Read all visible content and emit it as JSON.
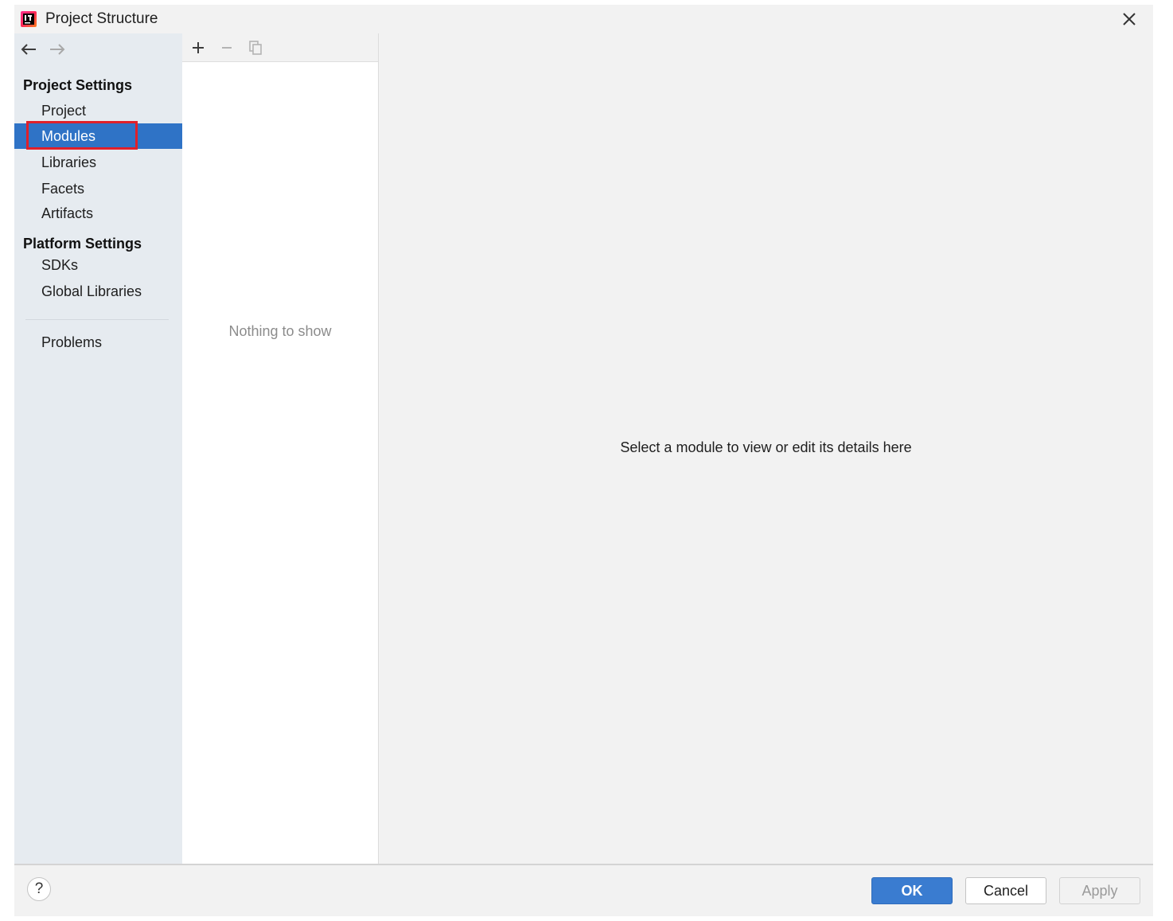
{
  "window": {
    "title": "Project Structure",
    "app_icon": "intellij-app-icon",
    "close_icon": "close-icon"
  },
  "sidebar": {
    "nav": {
      "back_icon": "arrow-left-icon",
      "forward_icon": "arrow-right-icon"
    },
    "sections": [
      {
        "header": "Project Settings",
        "items": [
          "Project",
          "Modules",
          "Libraries",
          "Facets",
          "Artifacts"
        ]
      },
      {
        "header": "Platform Settings",
        "items": [
          "SDKs",
          "Global Libraries"
        ]
      }
    ],
    "problems_label": "Problems",
    "selected_item": "Modules"
  },
  "list_panel": {
    "toolbar": {
      "add_icon": "plus-icon",
      "remove_icon": "minus-icon",
      "copy_icon": "copy-icon"
    },
    "empty_text": "Nothing to show"
  },
  "detail_panel": {
    "placeholder": "Select a module to view or edit its details here"
  },
  "footer": {
    "help_label": "?",
    "ok_label": "OK",
    "cancel_label": "Cancel",
    "apply_label": "Apply"
  },
  "colors": {
    "selection": "#2f73c6",
    "highlight_border": "#e0202a",
    "ok_button": "#3a7cd0",
    "sidebar_bg": "#e6ebf0"
  }
}
